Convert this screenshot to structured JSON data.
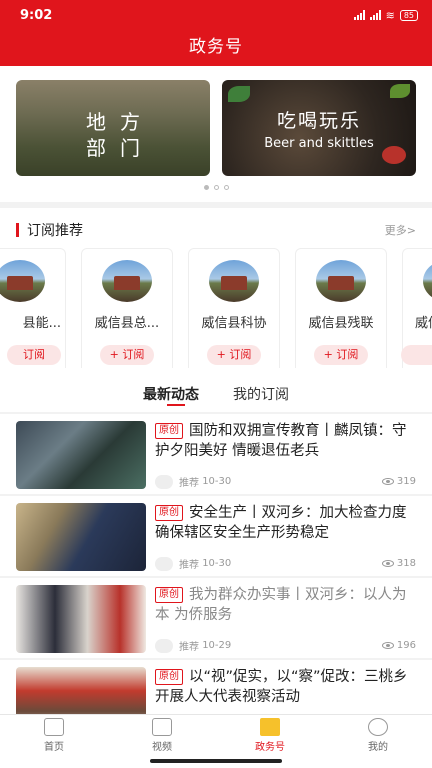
{
  "status": {
    "time": "9:02",
    "battery": "85"
  },
  "app": {
    "title": "政务号"
  },
  "banner": {
    "cards": [
      {
        "line1": "地方",
        "line2": "部门"
      },
      {
        "line1": "吃喝玩乐",
        "line2": "Beer and skittles"
      }
    ]
  },
  "recommend": {
    "title": "订阅推荐",
    "more": "更多>",
    "channels": [
      {
        "name": "县能...",
        "button": "订阅"
      },
      {
        "name": "威信县总...",
        "button": "+ 订阅"
      },
      {
        "name": "威信县科协",
        "button": "+ 订阅"
      },
      {
        "name": "威信县残联",
        "button": "+ 订阅"
      },
      {
        "name": "威信",
        "button": ""
      }
    ]
  },
  "tabs": [
    {
      "label": "最新动态"
    },
    {
      "label": "我的订阅"
    }
  ],
  "news": [
    {
      "tag": "原创",
      "title": "国防和双拥宣传教育丨麟凤镇：守护夕阳美好 情暖退伍老兵",
      "source": "推荐",
      "date": "10-30",
      "views": "319"
    },
    {
      "tag": "原创",
      "title": "安全生产丨双河乡：加大检查力度 确保辖区安全生产形势稳定",
      "source": "推荐",
      "date": "10-30",
      "views": "318"
    },
    {
      "tag": "原创",
      "title": "我为群众办实事丨双河乡：以人为本 为侨服务",
      "source": "推荐",
      "date": "10-29",
      "views": "196"
    },
    {
      "tag": "原创",
      "title": "以“视”促实，以“察”促改：三桃乡开展人大代表视察活动",
      "source": "",
      "date": "",
      "views": ""
    }
  ],
  "nav": [
    {
      "label": "首页"
    },
    {
      "label": "视频"
    },
    {
      "label": "政务号"
    },
    {
      "label": "我的"
    }
  ],
  "colors": {
    "brand": "#e0151c",
    "active_icon": "#f6c12b"
  }
}
